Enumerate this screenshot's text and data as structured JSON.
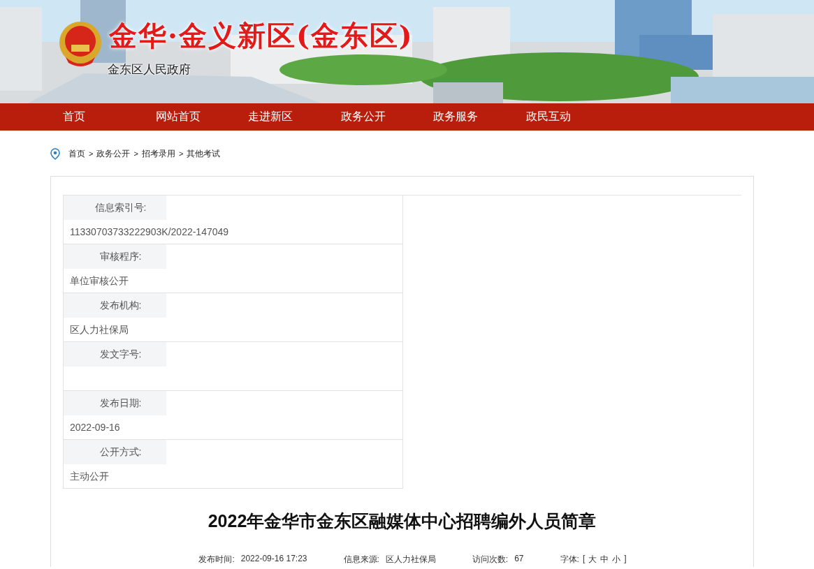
{
  "header": {
    "site_title": "金华·金义新区(金东区)",
    "site_subtitle": "金东区人民政府"
  },
  "nav": [
    {
      "label": "首页"
    },
    {
      "label": "网站首页"
    },
    {
      "label": "走进新区"
    },
    {
      "label": "政务公开"
    },
    {
      "label": "政务服务"
    },
    {
      "label": "政民互动"
    }
  ],
  "breadcrumb": [
    "首页",
    "政务公开",
    "招考录用",
    "其他考试"
  ],
  "breadcrumb_separator": ">",
  "info_table": [
    {
      "label": "信息索引号:",
      "value": "11330703733222903K/2022-147049"
    },
    {
      "label": "审核程序:",
      "value": "单位审核公开"
    },
    {
      "label": "发布机构:",
      "value": "区人力社保局"
    },
    {
      "label": "发文字号:"
    },
    {
      "label": "发布日期:",
      "value": "2022-09-16"
    },
    {
      "label": "公开方式:",
      "value": "主动公开"
    }
  ],
  "article": {
    "title": "2022年金华市金东区融媒体中心招聘编外人员简章",
    "meta": [
      {
        "label": "发布时间:",
        "value": "2022-09-16 17:23"
      },
      {
        "label": "信息来源:",
        "value": "区人力社保局"
      },
      {
        "label": "访问次数:",
        "value": "67"
      }
    ],
    "font_size": {
      "label": "字体:",
      "open": "[",
      "options": [
        "大",
        "中",
        "小"
      ],
      "close": "]"
    }
  }
}
